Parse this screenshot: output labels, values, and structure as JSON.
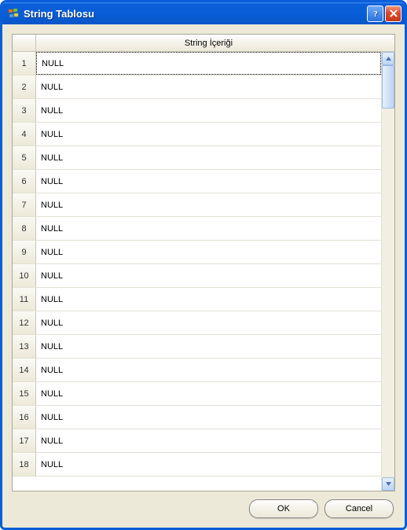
{
  "window": {
    "title": "String Tablosu"
  },
  "grid": {
    "column_header": "String İçeriği",
    "rows": [
      {
        "index": "1",
        "value": "NULL"
      },
      {
        "index": "2",
        "value": "NULL"
      },
      {
        "index": "3",
        "value": "NULL"
      },
      {
        "index": "4",
        "value": "NULL"
      },
      {
        "index": "5",
        "value": "NULL"
      },
      {
        "index": "6",
        "value": "NULL"
      },
      {
        "index": "7",
        "value": "NULL"
      },
      {
        "index": "8",
        "value": "NULL"
      },
      {
        "index": "9",
        "value": "NULL"
      },
      {
        "index": "10",
        "value": "NULL"
      },
      {
        "index": "11",
        "value": "NULL"
      },
      {
        "index": "12",
        "value": "NULL"
      },
      {
        "index": "13",
        "value": "NULL"
      },
      {
        "index": "14",
        "value": "NULL"
      },
      {
        "index": "15",
        "value": "NULL"
      },
      {
        "index": "16",
        "value": "NULL"
      },
      {
        "index": "17",
        "value": "NULL"
      },
      {
        "index": "18",
        "value": "NULL"
      }
    ],
    "selected_row": 0
  },
  "buttons": {
    "ok": "OK",
    "cancel": "Cancel"
  }
}
